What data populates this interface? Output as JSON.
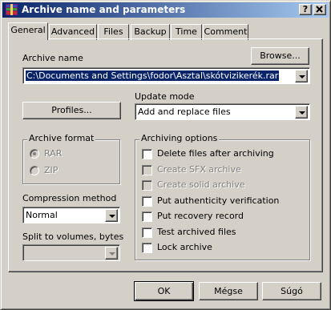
{
  "window": {
    "title": "Archive name and parameters",
    "help_button": "?",
    "close_button": "×"
  },
  "tabs": [
    {
      "label": "General"
    },
    {
      "label": "Advanced"
    },
    {
      "label": "Files"
    },
    {
      "label": "Backup"
    },
    {
      "label": "Time"
    },
    {
      "label": "Comment"
    }
  ],
  "archive_name": {
    "label": "Archive name",
    "value": "C:\\Documents and Settings\\fodor\\Asztal\\skótvizikerék.rar",
    "browse_button": "Browse..."
  },
  "profiles_button": "Profiles...",
  "update_mode": {
    "label": "Update mode",
    "value": "Add and replace files"
  },
  "archive_format": {
    "label": "Archive format",
    "options": [
      "RAR",
      "ZIP"
    ],
    "selected": "RAR"
  },
  "compression": {
    "label": "Compression method",
    "value": "Normal"
  },
  "split": {
    "label": "Split to volumes, bytes",
    "value": ""
  },
  "archiving_options": {
    "label": "Archiving options",
    "items": [
      {
        "label": "Delete files after archiving",
        "checked": false,
        "enabled": true
      },
      {
        "label": "Create SFX archive",
        "checked": false,
        "enabled": false
      },
      {
        "label": "Create solid archive",
        "checked": false,
        "enabled": false
      },
      {
        "label": "Put authenticity verification",
        "checked": false,
        "enabled": true
      },
      {
        "label": "Put recovery record",
        "checked": false,
        "enabled": true
      },
      {
        "label": "Test archived files",
        "checked": false,
        "enabled": true
      },
      {
        "label": "Lock archive",
        "checked": false,
        "enabled": true
      }
    ]
  },
  "buttons": {
    "ok": "OK",
    "cancel": "Mégse",
    "help": "Súgó"
  }
}
